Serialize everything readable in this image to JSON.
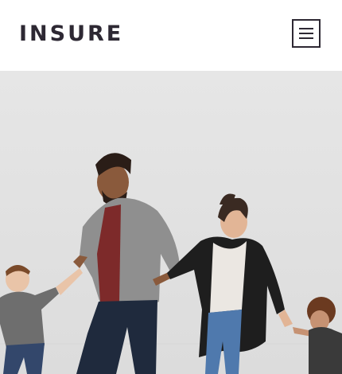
{
  "header": {
    "logo": "INSURE",
    "menu_icon": "hamburger-menu-icon"
  },
  "hero": {
    "image_name": "family-walking-photo"
  },
  "colors": {
    "text_dark": "#2d2833",
    "wall": "#e3e3e3",
    "background": "#ffffff"
  }
}
